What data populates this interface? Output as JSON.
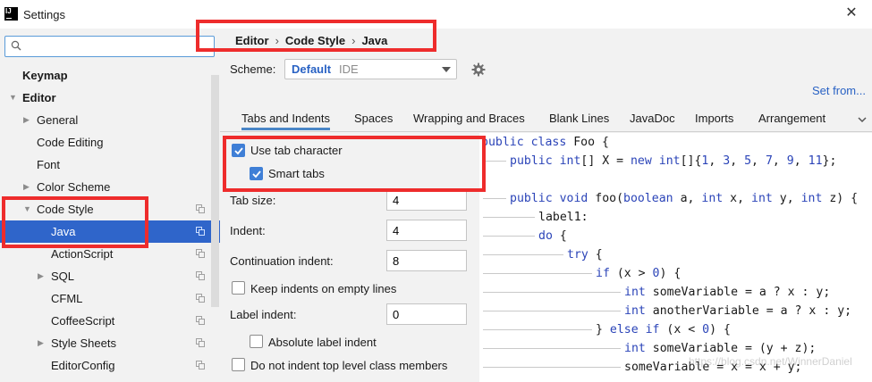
{
  "window": {
    "title": "Settings",
    "close_glyph": "✕"
  },
  "search": {
    "value": "",
    "placeholder": ""
  },
  "sidebar": {
    "items": [
      {
        "label": "Keymap"
      },
      {
        "label": "Editor"
      },
      {
        "label": "General"
      },
      {
        "label": "Code Editing"
      },
      {
        "label": "Font"
      },
      {
        "label": "Color Scheme"
      },
      {
        "label": "Code Style"
      },
      {
        "label": "Java"
      },
      {
        "label": "ActionScript"
      },
      {
        "label": "SQL"
      },
      {
        "label": "CFML"
      },
      {
        "label": "CoffeeScript"
      },
      {
        "label": "Style Sheets"
      },
      {
        "label": "EditorConfig"
      }
    ]
  },
  "breadcrumb": {
    "items": [
      "Editor",
      "Code Style",
      "Java"
    ],
    "separator": "›"
  },
  "scheme": {
    "label": "Scheme:",
    "name": "Default",
    "type": "IDE"
  },
  "set_from": "Set from...",
  "tabs": [
    "Tabs and Indents",
    "Spaces",
    "Wrapping and Braces",
    "Blank Lines",
    "JavaDoc",
    "Imports",
    "Arrangement"
  ],
  "options": {
    "use_tab_character": {
      "label": "Use tab character",
      "checked": true
    },
    "smart_tabs": {
      "label": "Smart tabs",
      "checked": true
    },
    "tab_size": {
      "label": "Tab size:",
      "value": "4"
    },
    "indent": {
      "label": "Indent:",
      "value": "4"
    },
    "continuation_indent": {
      "label": "Continuation indent:",
      "value": "8"
    },
    "keep_indents_empty": {
      "label": "Keep indents on empty lines",
      "checked": false
    },
    "label_indent": {
      "label": "Label indent:",
      "value": "0"
    },
    "absolute_label_indent": {
      "label": "Absolute label indent",
      "checked": false
    },
    "no_indent_top_level": {
      "label": "Do not indent top level class members",
      "checked": false
    }
  },
  "code": {
    "lines": [
      [
        "public class ",
        "Foo {"
      ],
      [
        "public ",
        "int",
        "[] X = ",
        "new ",
        "int",
        "[]{",
        "1",
        ", ",
        "3",
        ", ",
        "5",
        ", ",
        "7",
        ", ",
        "9",
        ", ",
        "11",
        "};"
      ],
      [],
      [
        "public void ",
        "foo(",
        "boolean ",
        "a, ",
        "int ",
        "x, ",
        "int ",
        "y, ",
        "int ",
        "z) {"
      ],
      [
        "label1:"
      ],
      [
        "do ",
        "{"
      ],
      [
        "try ",
        "{"
      ],
      [
        "if ",
        "(x > ",
        "0",
        ") {"
      ],
      [
        "int ",
        "someVariable = a ? x : y;"
      ],
      [
        "int ",
        "anotherVariable = a ? x : y;"
      ],
      [
        "} ",
        "else if ",
        "(x < ",
        "0",
        ") {"
      ],
      [
        "int ",
        "someVariable = (y + z);"
      ],
      [
        "someVariable = x = x + y;"
      ]
    ]
  },
  "watermark": "https://blog.csdn.net/WinnerDaniel",
  "colors": {
    "accent": "#2f65ca",
    "keyword": "#2b44b8",
    "annotation": "#ee2c2c"
  }
}
